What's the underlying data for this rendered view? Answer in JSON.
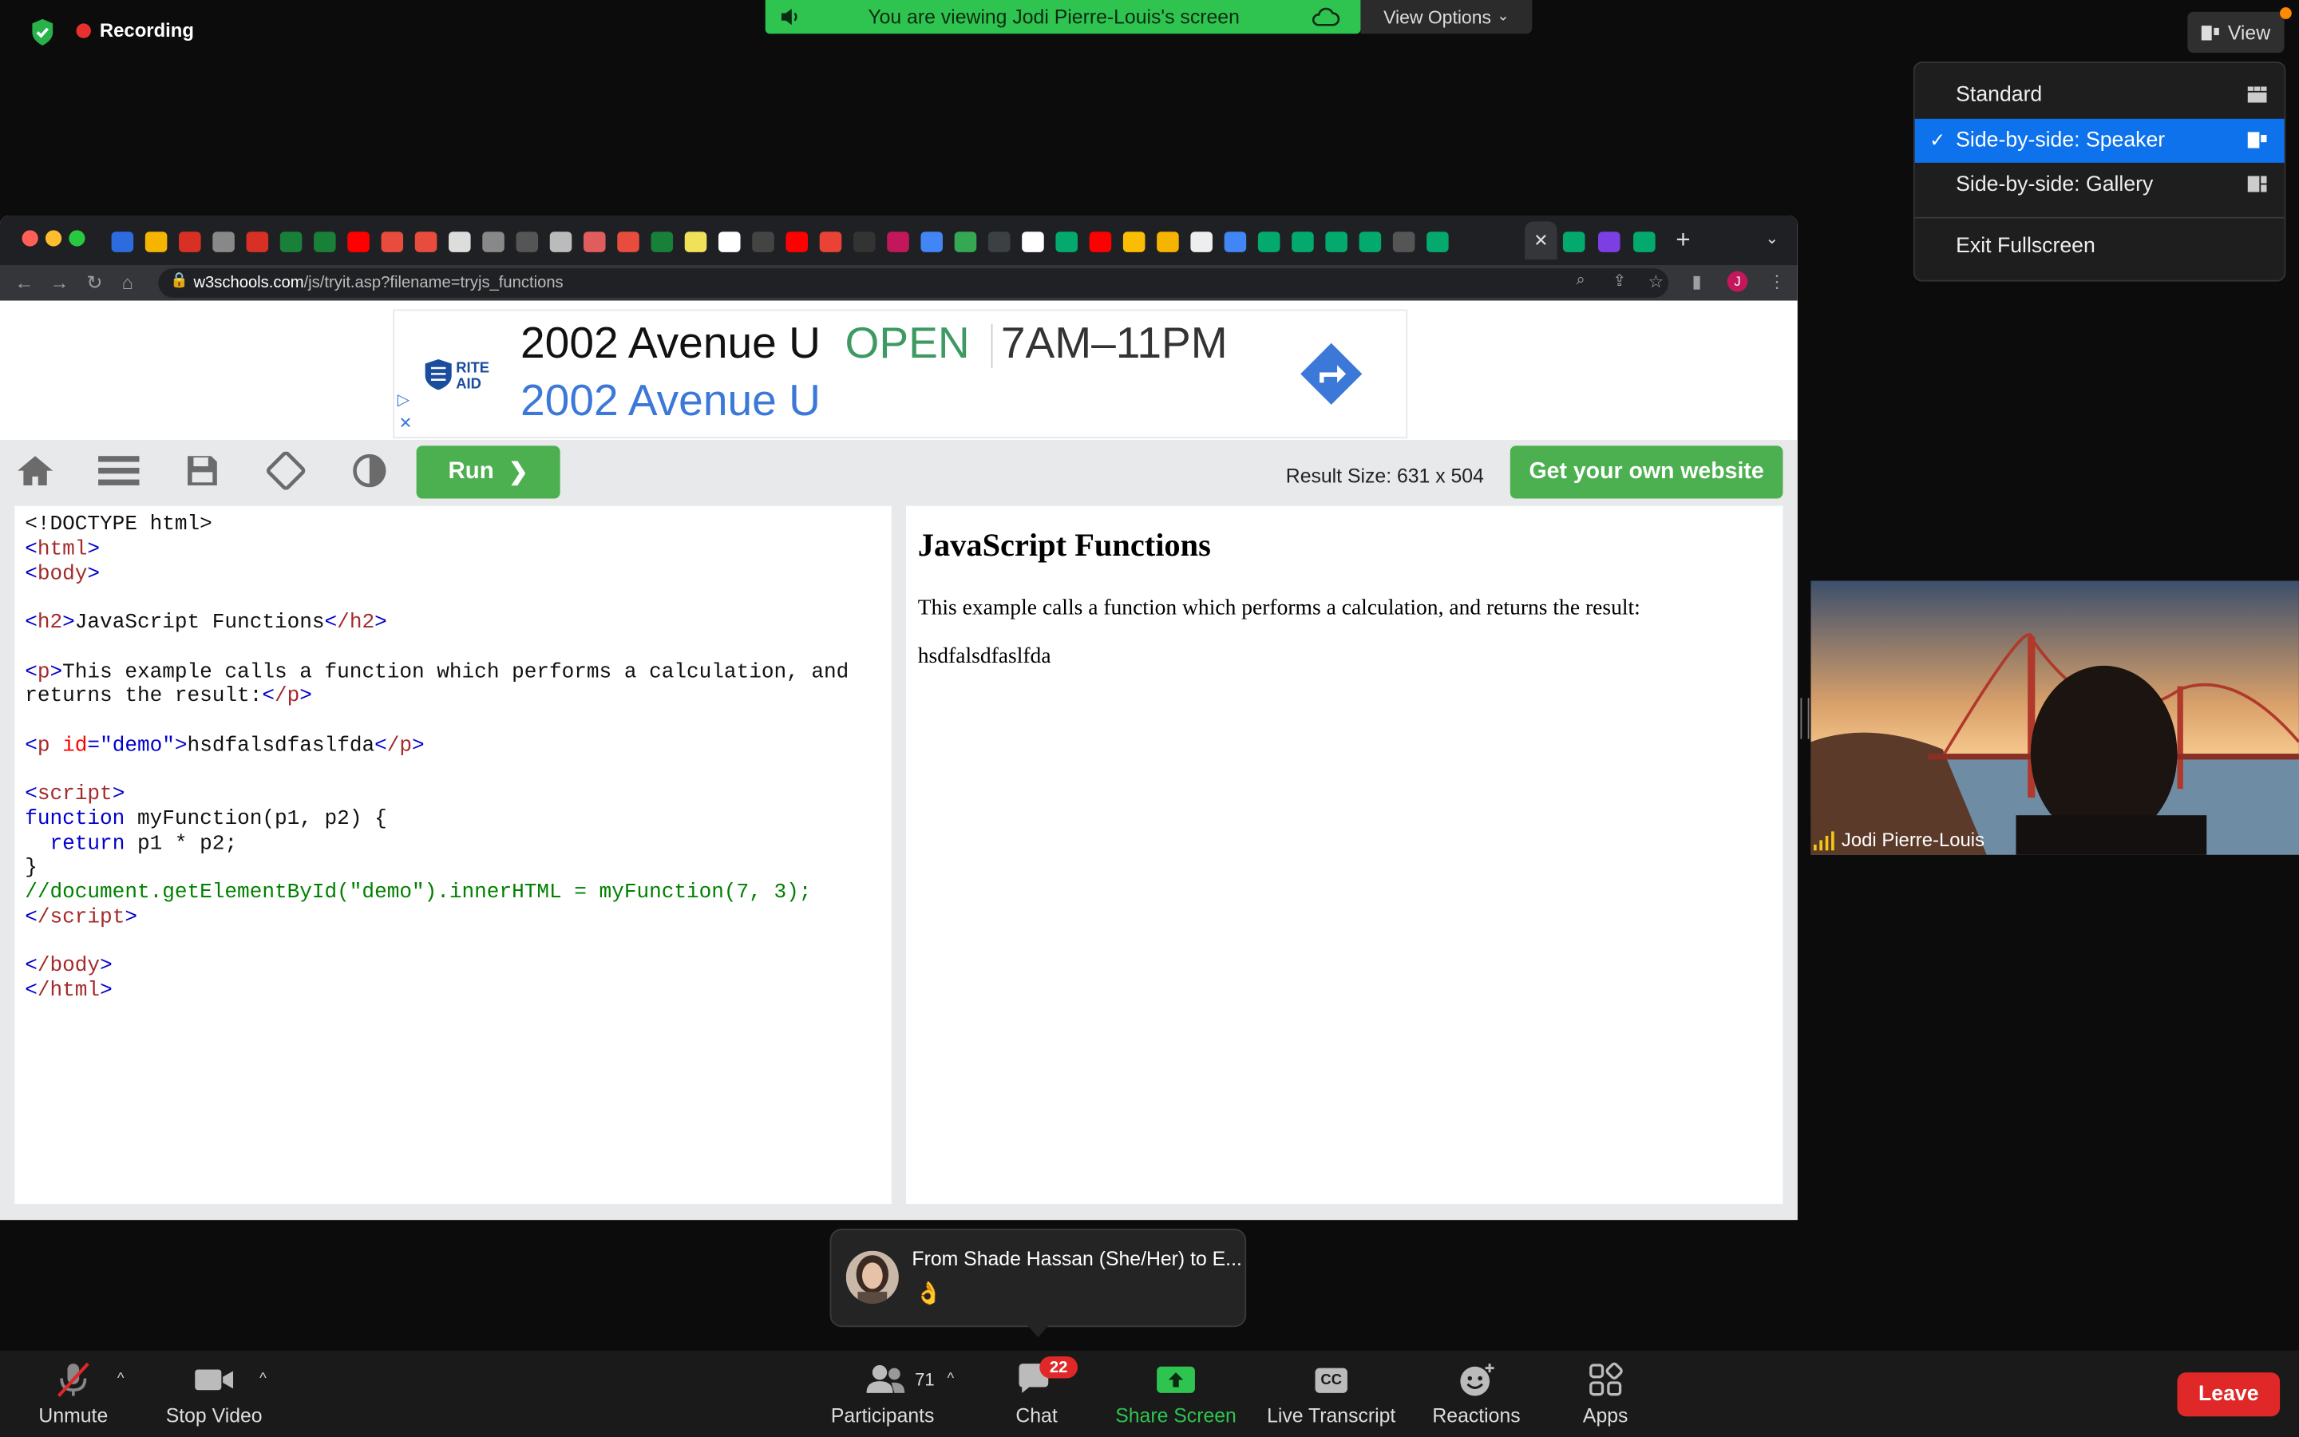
{
  "topbar": {
    "recording_label": "Recording",
    "viewing_banner": "You are viewing Jodi Pierre-Louis's screen",
    "view_options_label": "View Options",
    "view_button_label": "View"
  },
  "view_menu": {
    "items": [
      {
        "label": "Standard",
        "selected": false
      },
      {
        "label": "Side-by-side: Speaker",
        "selected": true
      },
      {
        "label": "Side-by-side: Gallery",
        "selected": false
      }
    ],
    "exit_label": "Exit Fullscreen",
    "check_mark": "✓"
  },
  "browser": {
    "url_host": "w3schools.com",
    "url_path": "/js/tryit.asp?filename=tryjs_functions",
    "profile_initial": "J"
  },
  "ad": {
    "line1_address": "2002 Avenue U",
    "line1_status": "OPEN",
    "line1_hours": "7AM–11PM",
    "line2": "2002 Avenue U",
    "brand_line1": "RITE",
    "brand_line2": "AID"
  },
  "editor": {
    "run_label": "Run",
    "result_size": "Result Size: 631 x 504",
    "get_website_label": "Get your own website",
    "code": {
      "doctype": "<!DOCTYPE html>",
      "html_open": "html",
      "body_open": "body",
      "h2_open": "h2",
      "h2_text": "JavaScript Functions",
      "h2_close": "/h2",
      "p_open": "p",
      "p_text_1": "This example calls a function which performs a calculation, and",
      "p_text_2": "returns the result:",
      "p_close": "/p",
      "p_id_attr": "id",
      "p_id_val": "\"demo\"",
      "p_demo_text": "hsdfalsdfaslfda",
      "script_open": "script",
      "fn_kw": "function",
      "fn_sig": " myFunction(p1, p2) {",
      "return_kw": "return",
      "return_expr": " p1 * p2;",
      "close_brace": "}",
      "comment_line": "//document.getElementById(\"demo\").innerHTML = myFunction(7, 3);",
      "script_close": "/script",
      "body_close": "/body",
      "html_close": "/html"
    }
  },
  "result": {
    "heading": "JavaScript Functions",
    "paragraph": "This example calls a function which performs a calculation, and returns the result:",
    "demo": "hsdfalsdfaslfda"
  },
  "video": {
    "participant_name": "Jodi Pierre-Louis"
  },
  "chat_popup": {
    "from": "From Shade Hassan (She/Her) to E...",
    "message": "👌"
  },
  "bottom_bar": {
    "unmute": "Unmute",
    "stop_video": "Stop Video",
    "participants": "Participants",
    "participants_count": "71",
    "chat": "Chat",
    "chat_badge": "22",
    "share_screen": "Share Screen",
    "live_transcript": "Live Transcript",
    "cc_label": "CC",
    "reactions": "Reactions",
    "apps": "Apps",
    "leave": "Leave"
  },
  "colors": {
    "banner_green": "#2ec44f",
    "menu_selected": "#0e72ed",
    "run_green": "#4caf50",
    "leave_red": "#e02828"
  }
}
